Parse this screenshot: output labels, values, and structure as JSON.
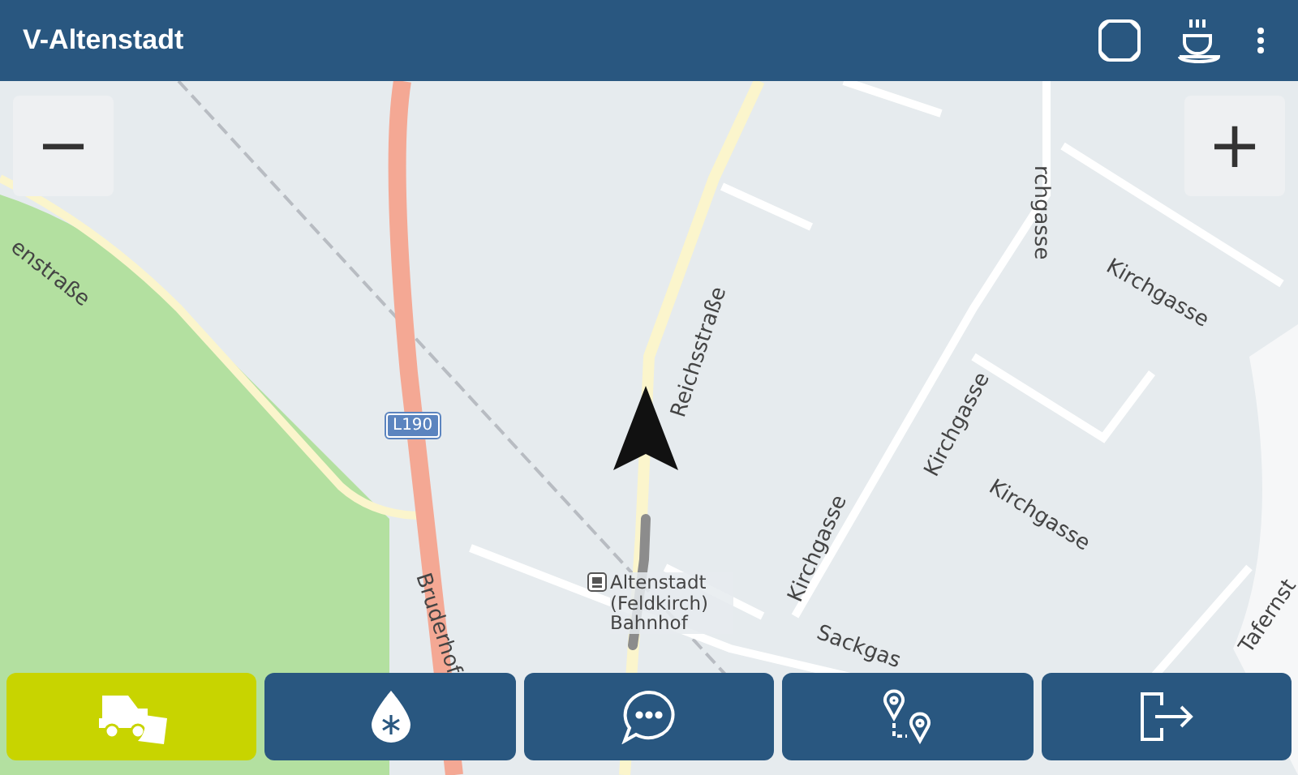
{
  "header": {
    "title": "V-Altenstadt"
  },
  "map": {
    "zoom_out": "−",
    "zoom_in": "+",
    "labels": [
      {
        "text": "enstraße"
      },
      {
        "text": "L190",
        "kind": "badge"
      },
      {
        "text": "Reichsstraße"
      },
      {
        "text": "rchgasse"
      },
      {
        "text": "Kirchgasse"
      },
      {
        "text": "Kirchgasse"
      },
      {
        "text": "Kirchgasse"
      },
      {
        "text": "Kirchgasse"
      },
      {
        "text": "Sackgas"
      },
      {
        "text": "Bruderhof"
      },
      {
        "text": "Tafernst"
      },
      {
        "text": "Altenstadt (Feldkirch) Bahnhof",
        "kind": "station"
      }
    ]
  },
  "bottom_buttons": [
    {
      "kind": "plow",
      "selected": true
    },
    {
      "kind": "salt",
      "selected": false
    },
    {
      "kind": "chat",
      "selected": false
    },
    {
      "kind": "route",
      "selected": false
    },
    {
      "kind": "exit",
      "selected": false
    }
  ]
}
